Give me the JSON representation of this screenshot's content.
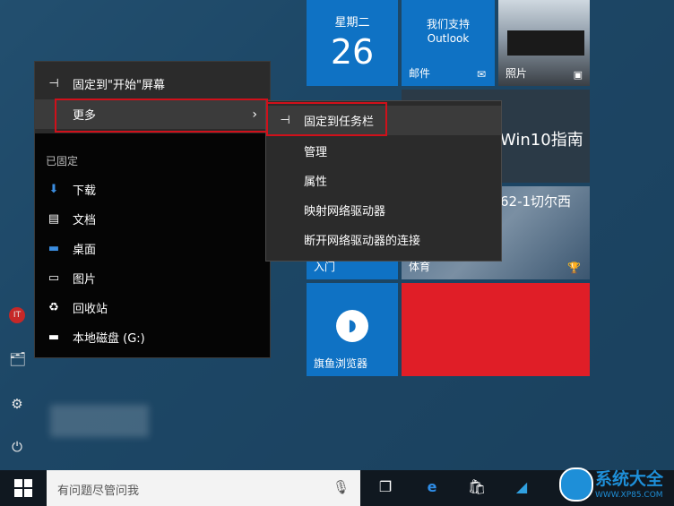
{
  "tiles": {
    "calendar": {
      "day": "星期二",
      "date": "26"
    },
    "mail": {
      "line1": "我们支持",
      "line2": "Outlook",
      "label": "邮件"
    },
    "photos": {
      "label": "照片"
    },
    "news": {
      "title": "Win10指南"
    },
    "sports": {
      "headline": "62-1切尔西",
      "label": "体育"
    },
    "getstarted": {
      "label": "入门"
    },
    "browser": {
      "label": "旗鱼浏览器"
    }
  },
  "context_menu": {
    "pin_start": "固定到\"开始\"屏幕",
    "more": "更多",
    "pinned_header": "已固定",
    "items": [
      {
        "label": "下载",
        "icon": "download-icon"
      },
      {
        "label": "文档",
        "icon": "document-icon"
      },
      {
        "label": "桌面",
        "icon": "desktop-icon"
      },
      {
        "label": "图片",
        "icon": "picture-icon"
      },
      {
        "label": "回收站",
        "icon": "recycle-bin-icon"
      },
      {
        "label": "本地磁盘 (G:)",
        "icon": "drive-icon"
      }
    ]
  },
  "submenu": {
    "items": [
      "固定到任务栏",
      "管理",
      "属性",
      "映射网络驱动器",
      "断开网络驱动器的连接"
    ]
  },
  "taskbar": {
    "search_placeholder": "有问题尽管问我"
  },
  "watermark": {
    "text": "系统大全",
    "url": "WWW.XP85.COM"
  },
  "colors": {
    "tile_blue": "#0f72c4",
    "tile_red": "#e01e27",
    "highlight": "#d0101a"
  }
}
